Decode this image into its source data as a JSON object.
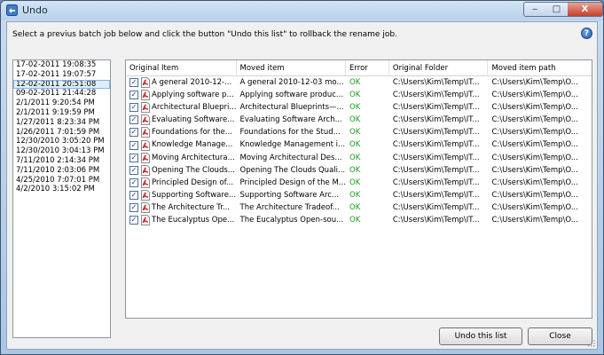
{
  "window": {
    "title": "Undo",
    "controls": {
      "minimize": "‒",
      "maximize": "□",
      "close": "X"
    }
  },
  "instruction": "Select a previus batch job below and click the button \"Undo this list\" to rollback the rename job.",
  "help_symbol": "?",
  "batches": [
    "17-02-2011 19:08:35",
    "17-02-2011 19:07:57",
    "12-02-2011 20:51:08",
    "09-02-2011 21:44:28",
    "2/1/2011 9:20:54 PM",
    "2/1/2011 9:19:59 PM",
    "1/27/2011 8:23:34 PM",
    "1/26/2011 7:01:59 PM",
    "12/30/2010 3:05:20 PM",
    "12/30/2010 3:04:13 PM",
    "7/11/2010 2:14:34 PM",
    "7/11/2010 2:03:06 PM",
    "4/25/2010 7:07:01 PM",
    "4/2/2010 3:15:02 PM"
  ],
  "selected_batch_index": 2,
  "grid": {
    "columns": [
      "Original Item",
      "Moved item",
      "Error",
      "Original Folder",
      "Moved item path"
    ],
    "rows": [
      {
        "checked": "✓",
        "original": "A general 2010-12-...",
        "moved": "A general 2010-12-03 mo...",
        "error": "OK",
        "folder": "C:\\Users\\Kim\\Temp\\IT...",
        "path": "C:\\Users\\Kim\\Temp\\O..."
      },
      {
        "checked": "✓",
        "original": "Applying software p...",
        "moved": "Applying software produc...",
        "error": "OK",
        "folder": "C:\\Users\\Kim\\Temp\\IT...",
        "path": "C:\\Users\\Kim\\Temp\\O..."
      },
      {
        "checked": "✓",
        "original": "Architectural Bluepri...",
        "moved": "Architectural Blueprints—...",
        "error": "OK",
        "folder": "C:\\Users\\Kim\\Temp\\IT...",
        "path": "C:\\Users\\Kim\\Temp\\O..."
      },
      {
        "checked": "✓",
        "original": "Evaluating Software...",
        "moved": "Evaluating Software Arch...",
        "error": "OK",
        "folder": "C:\\Users\\Kim\\Temp\\IT...",
        "path": "C:\\Users\\Kim\\Temp\\O..."
      },
      {
        "checked": "✓",
        "original": "Foundations for the...",
        "moved": "Foundations for the Stud...",
        "error": "OK",
        "folder": "C:\\Users\\Kim\\Temp\\IT...",
        "path": "C:\\Users\\Kim\\Temp\\O..."
      },
      {
        "checked": "✓",
        "original": "Knowledge Manage...",
        "moved": "Knowledge Management i...",
        "error": "OK",
        "folder": "C:\\Users\\Kim\\Temp\\IT...",
        "path": "C:\\Users\\Kim\\Temp\\O..."
      },
      {
        "checked": "✓",
        "original": "Moving Architectura...",
        "moved": "Moving Architectural Des...",
        "error": "OK",
        "folder": "C:\\Users\\Kim\\Temp\\IT...",
        "path": "C:\\Users\\Kim\\Temp\\O..."
      },
      {
        "checked": "✓",
        "original": "Opening The Clouds...",
        "moved": "Opening The Clouds Quali...",
        "error": "OK",
        "folder": "C:\\Users\\Kim\\Temp\\IT...",
        "path": "C:\\Users\\Kim\\Temp\\O..."
      },
      {
        "checked": "✓",
        "original": "Principled Design of...",
        "moved": "Principled Design of the M...",
        "error": "OK",
        "folder": "C:\\Users\\Kim\\Temp\\IT...",
        "path": "C:\\Users\\Kim\\Temp\\O..."
      },
      {
        "checked": "✓",
        "original": "Supporting Software...",
        "moved": "Supporting Software Arc...",
        "error": "OK",
        "folder": "C:\\Users\\Kim\\Temp\\IT...",
        "path": "C:\\Users\\Kim\\Temp\\O..."
      },
      {
        "checked": "✓",
        "original": "The Architecture Tr...",
        "moved": "The Architecture Tradeof...",
        "error": "OK",
        "folder": "C:\\Users\\Kim\\Temp\\IT...",
        "path": "C:\\Users\\Kim\\Temp\\O..."
      },
      {
        "checked": "✓",
        "original": "The Eucalyptus Ope...",
        "moved": "The Eucalyptus Open-sou...",
        "error": "OK",
        "folder": "C:\\Users\\Kim\\Temp\\IT...",
        "path": "C:\\Users\\Kim\\Temp\\O..."
      }
    ]
  },
  "buttons": {
    "undo": "Undo this list",
    "close": "Close"
  },
  "colors": {
    "ok_status": "#1a9c1a",
    "selection": "#dfeefc",
    "pdf_red": "#c8231a"
  }
}
